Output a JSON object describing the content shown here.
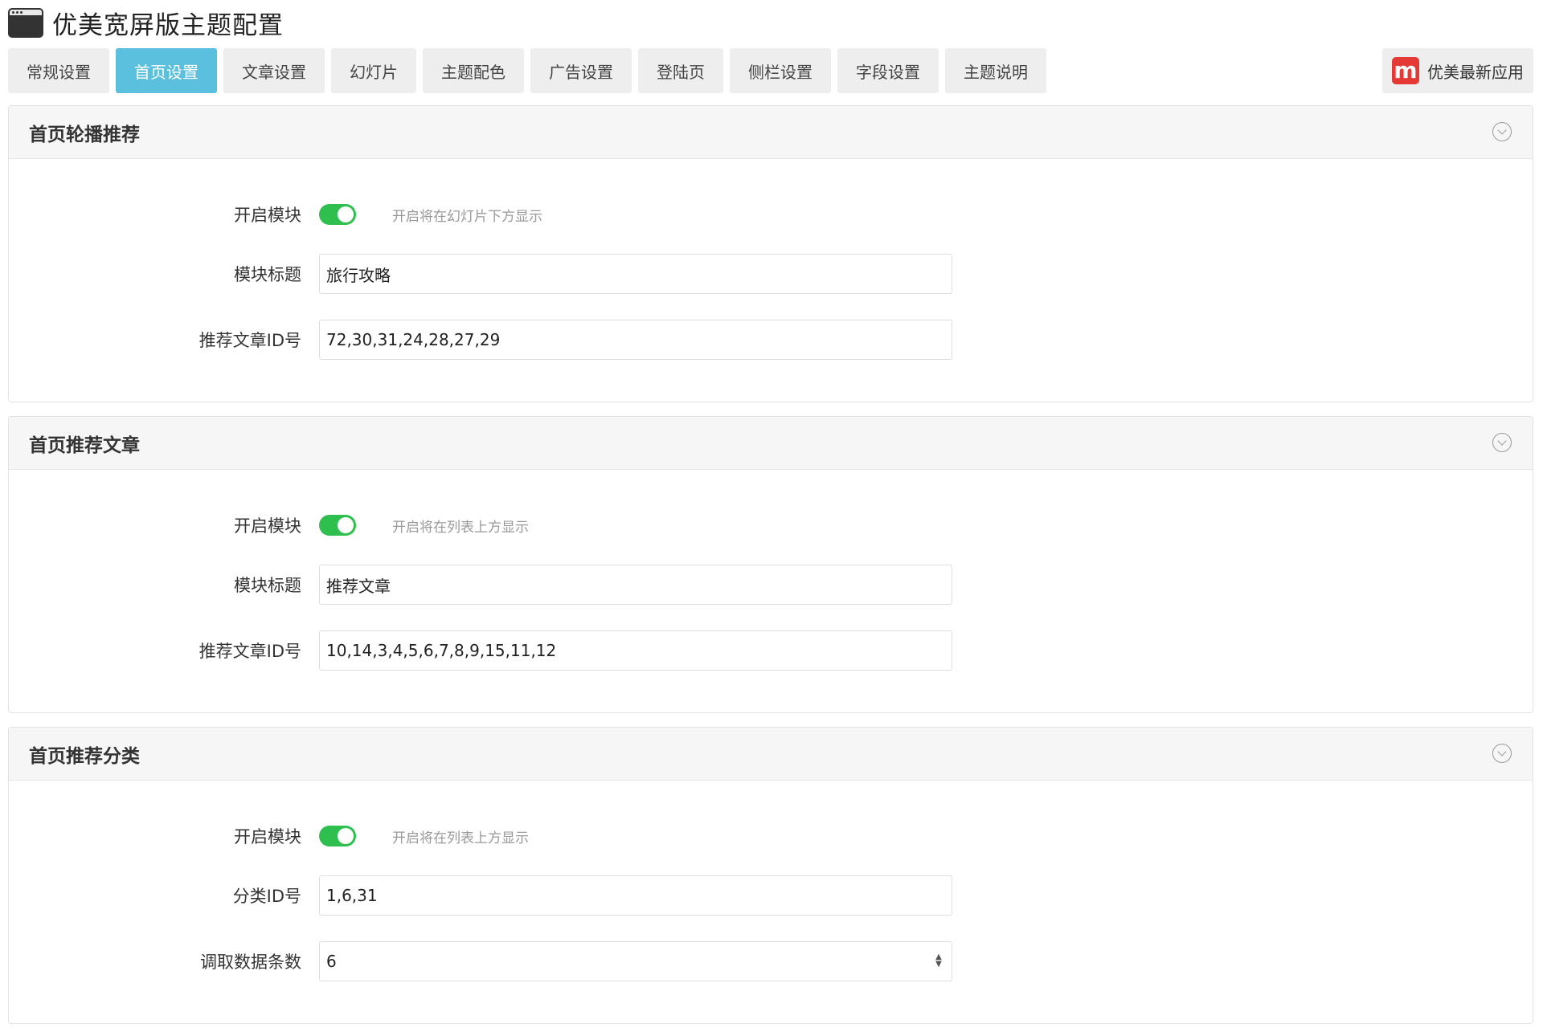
{
  "header": {
    "title": "优美宽屏版主题配置",
    "icon": "window-icon"
  },
  "tabs": [
    {
      "label": "常规设置",
      "active": false
    },
    {
      "label": "首页设置",
      "active": true
    },
    {
      "label": "文章设置",
      "active": false
    },
    {
      "label": "幻灯片",
      "active": false
    },
    {
      "label": "主题配色",
      "active": false
    },
    {
      "label": "广告设置",
      "active": false
    },
    {
      "label": "登陆页",
      "active": false
    },
    {
      "label": "侧栏设置",
      "active": false
    },
    {
      "label": "字段设置",
      "active": false
    },
    {
      "label": "主题说明",
      "active": false
    }
  ],
  "latest_apps": {
    "logo_letter": "m",
    "label": "优美最新应用"
  },
  "colors": {
    "accent": "#5bc0de",
    "toggle_on": "#2fbf4f",
    "logo_red": "#e53935"
  },
  "panels": [
    {
      "title": "首页轮播推荐",
      "enable_label": "开启模块",
      "enabled": true,
      "enable_hint": "开启将在幻灯片下方显示",
      "module_title_label": "模块标题",
      "module_title_value": "旅行攻略",
      "ids_label": "推荐文章ID号",
      "ids_value": "72,30,31,24,28,27,29"
    },
    {
      "title": "首页推荐文章",
      "enable_label": "开启模块",
      "enabled": true,
      "enable_hint": "开启将在列表上方显示",
      "module_title_label": "模块标题",
      "module_title_value": "推荐文章",
      "ids_label": "推荐文章ID号",
      "ids_value": "10,14,3,4,5,6,7,8,9,15,11,12"
    },
    {
      "title": "首页推荐分类",
      "enable_label": "开启模块",
      "enabled": true,
      "enable_hint": "开启将在列表上方显示",
      "category_ids_label": "分类ID号",
      "category_ids_value": "1,6,31",
      "count_label": "调取数据条数",
      "count_value": "6"
    }
  ]
}
